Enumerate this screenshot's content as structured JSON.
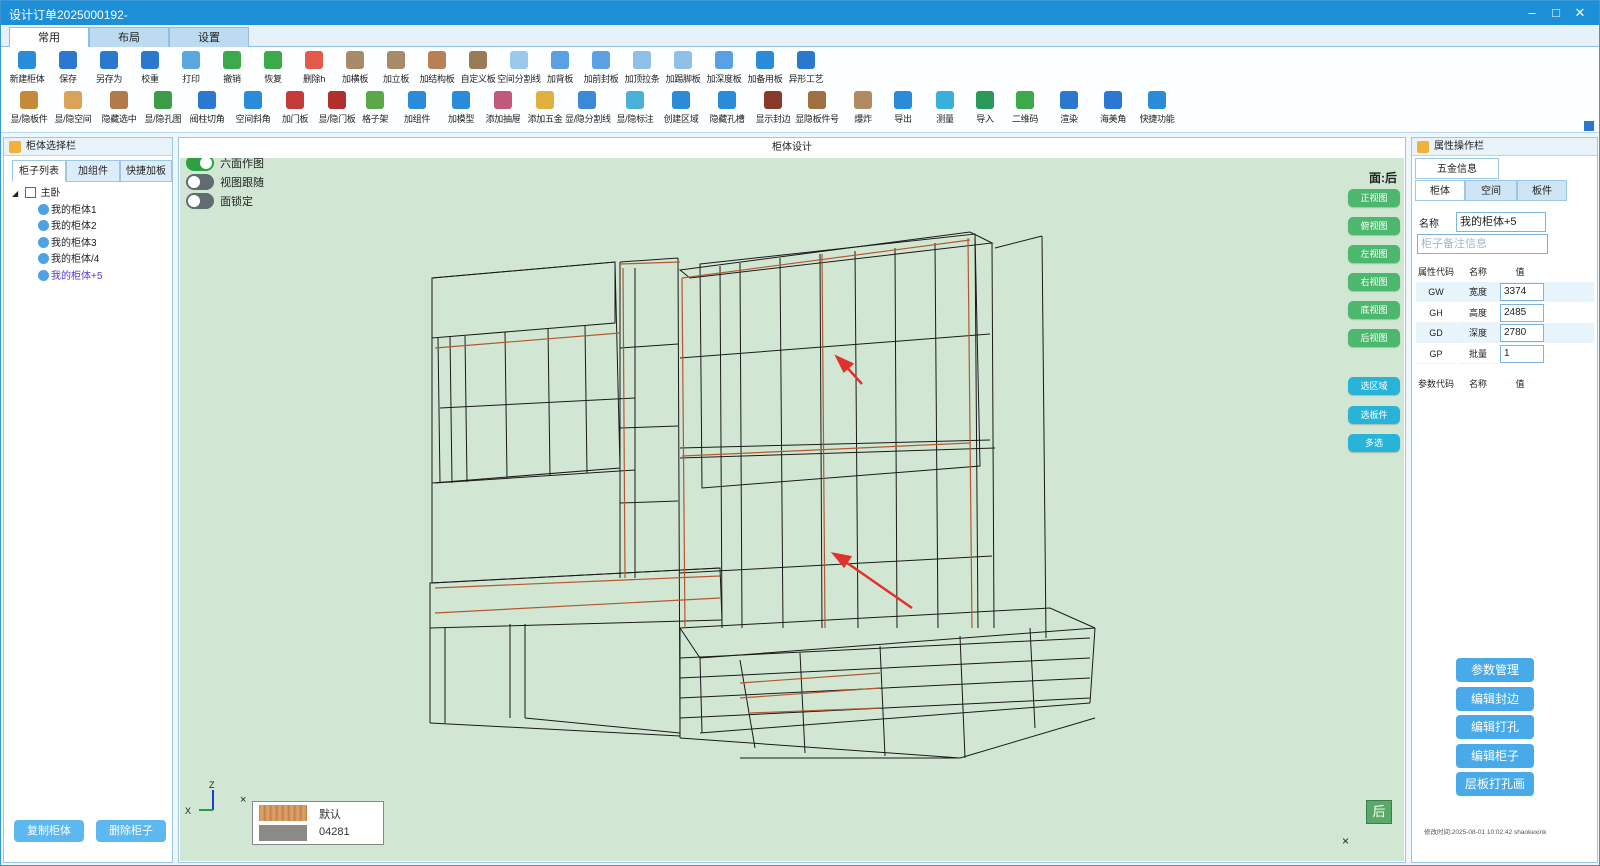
{
  "window": {
    "title": "设计订单2025000192-",
    "controls": [
      "–",
      "□",
      "✕"
    ]
  },
  "ribbon_tabs": [
    "常用",
    "布局",
    "设置"
  ],
  "toolbar_row1": [
    {
      "label": "新建柜体",
      "color": "#2a8bd8"
    },
    {
      "label": "保存",
      "color": "#2a78d0"
    },
    {
      "label": "另存为",
      "color": "#2a78d0"
    },
    {
      "label": "校重",
      "color": "#2a78d0"
    },
    {
      "label": "打印",
      "color": "#5aa7e0"
    },
    {
      "label": "撤销",
      "color": "#3caa4b"
    },
    {
      "label": "恢复",
      "color": "#3caa4b"
    },
    {
      "label": "删除h",
      "color": "#e25a4a"
    },
    {
      "label": "加横板",
      "color": "#a78a6a"
    },
    {
      "label": "加立板",
      "color": "#a78a6a"
    },
    {
      "label": "加结构板",
      "color": "#b88055"
    },
    {
      "label": "自定义板",
      "color": "#9a7b58"
    },
    {
      "label": "空间分割线",
      "color": "#9bc9ee"
    },
    {
      "label": "加背板",
      "color": "#5aa0e3"
    },
    {
      "label": "加前封板",
      "color": "#5aa0e3"
    },
    {
      "label": "加顶拉条",
      "color": "#8fc0e8"
    },
    {
      "label": "加踢脚板",
      "color": "#8fc0e8"
    },
    {
      "label": "加深度板",
      "color": "#5aa0e3"
    },
    {
      "label": "加备用板",
      "color": "#2a8bd8"
    },
    {
      "label": "异形工艺",
      "color": "#2a78d0"
    }
  ],
  "toolbar_row2": [
    {
      "label": "显/隐板件",
      "color": "#c48a3a"
    },
    {
      "label": "显/隐空间",
      "color": "#d9a45a"
    },
    {
      "label": "隐藏选中",
      "color": "#b07a4a"
    },
    {
      "label": "显/隐孔图",
      "color": "#3c9c4a"
    },
    {
      "label": "阀柱切角",
      "color": "#2a78d0"
    },
    {
      "label": "空间斜角",
      "color": "#2a8bd8"
    },
    {
      "label": "加门板",
      "color": "#c23a3a"
    },
    {
      "label": "显/隐门板",
      "color": "#b03030"
    },
    {
      "label": "格子架",
      "color": "#5aa84a"
    },
    {
      "label": "加组件",
      "color": "#2a8bd8"
    },
    {
      "label": "加模型",
      "color": "#2a8bd8"
    },
    {
      "label": "添加抽屉",
      "color": "#c05a7a"
    },
    {
      "label": "添加五金",
      "color": "#e0b040"
    },
    {
      "label": "显/隐分割线",
      "color": "#3a8ad8"
    },
    {
      "label": "显/隐标注",
      "color": "#4ab0d8"
    },
    {
      "label": "创建区域",
      "color": "#2a8bd8"
    },
    {
      "label": "隐藏孔槽",
      "color": "#2a8bd8"
    },
    {
      "label": "显示封边",
      "color": "#8a3a2a"
    },
    {
      "label": "显隐板件号",
      "color": "#a07040"
    },
    {
      "label": "爆炸",
      "color": "#b08a60"
    },
    {
      "label": "导出",
      "color": "#2a8bd8"
    },
    {
      "label": "测量",
      "color": "#3ab0d8"
    },
    {
      "label": "导入",
      "color": "#2a9a5a"
    },
    {
      "label": "二维码",
      "color": "#3caa4b"
    },
    {
      "label": "渲染",
      "color": "#2a78d0"
    },
    {
      "label": "海美角",
      "color": "#2a78d0"
    },
    {
      "label": "快捷功能",
      "color": "#2a8bd8"
    }
  ],
  "left_panel": {
    "title": "柜体选择栏",
    "tabs": [
      "柜子列表",
      "加组件",
      "快捷加板"
    ],
    "tree_root": "主卧",
    "tree_items": [
      "我的柜体1",
      "我的柜体2",
      "我的柜体3",
      "我的柜体/4",
      "我的柜体+5"
    ],
    "copy_button": "复制柜体",
    "delete_button": "删除柜子"
  },
  "center": {
    "title": "柜体设计",
    "toggles": [
      {
        "label": "六面作图",
        "on": true
      },
      {
        "label": "视图跟随",
        "on": false
      },
      {
        "label": "面锁定",
        "on": false
      }
    ],
    "face_label": "面:后",
    "view_buttons": [
      "正视图",
      "俯视图",
      "左视图",
      "右视图",
      "底视图",
      "后视图"
    ],
    "action_buttons": [
      "选区域",
      "选板件",
      "多选"
    ],
    "axes": {
      "z": "Z",
      "x": "X"
    },
    "close_glyph": "×",
    "materials": [
      "默认",
      "04281"
    ],
    "corner_badge": "后"
  },
  "right_panel": {
    "title": "属性操作栏",
    "subtab": "五金信息",
    "tabs": [
      "柜体",
      "空间",
      "板件"
    ],
    "name_label": "名称",
    "name_value": "我的柜体+5",
    "remark_placeholder": "柜子备注信息",
    "prop_headers": [
      "属性代码",
      "名称",
      "值"
    ],
    "props": [
      {
        "code": "GW",
        "name": "宽度",
        "value": "3374"
      },
      {
        "code": "GH",
        "name": "高度",
        "value": "2485"
      },
      {
        "code": "GD",
        "name": "深度",
        "value": "2780"
      },
      {
        "code": "GP",
        "name": "批量",
        "value": "1"
      }
    ],
    "param_headers": [
      "参数代码",
      "名称",
      "值"
    ],
    "buttons": [
      "参数管理",
      "编辑封边",
      "编辑打孔",
      "编辑柜子",
      "层板打孔画"
    ],
    "footer": "修改时间:2025-08-01 10:02:42 shaokexink"
  }
}
